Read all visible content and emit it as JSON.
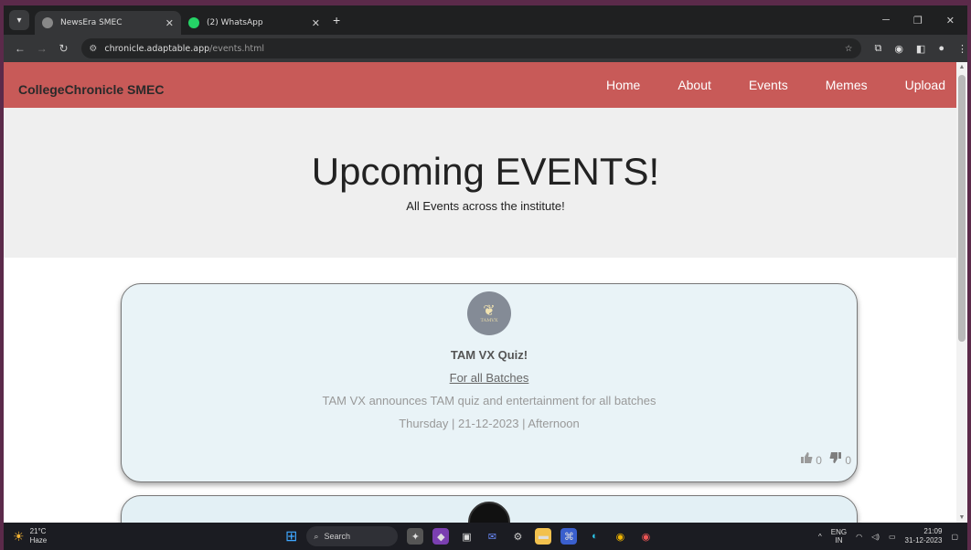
{
  "browser": {
    "tabs": [
      {
        "title": "NewsEra SMEC",
        "active": true
      },
      {
        "title": "(2) WhatsApp",
        "active": false
      }
    ],
    "new_tab": "+",
    "url_host": "chronicle.adaptable.app",
    "url_path": "/events.html"
  },
  "site": {
    "brand": "CollegeChronicle SMEC",
    "nav": [
      "Home",
      "About",
      "Events",
      "Memes",
      "Upload"
    ]
  },
  "hero": {
    "title": "Upcoming EVENTS!",
    "subtitle": "All Events across the institute!"
  },
  "events": [
    {
      "logo_text": "TAMVX",
      "title": "TAM VX Quiz!",
      "audience": "For all Batches",
      "description": "TAM VX announces TAM quiz and entertainment for all batches",
      "date": "Thursday | 21-12-2023 | Afternoon",
      "likes": "0",
      "dislikes": "0"
    }
  ],
  "taskbar": {
    "temp": "21°C",
    "weather": "Haze",
    "search": "Search",
    "lang1": "ENG",
    "lang2": "IN",
    "time": "21:09",
    "date": "31-12-2023"
  },
  "colors": {
    "navbar": "#c85a58",
    "card_bg": "#e9f3f7",
    "hero_bg": "#efefef"
  }
}
